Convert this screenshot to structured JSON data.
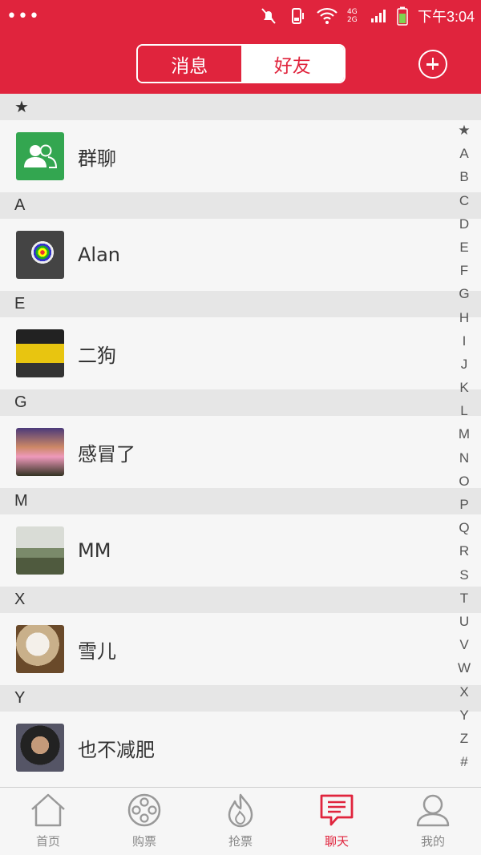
{
  "status_bar": {
    "time": "下午3:04",
    "network": "4G 2G"
  },
  "header": {
    "tabs": [
      {
        "label": "消息",
        "active": false
      },
      {
        "label": "好友",
        "active": true
      }
    ],
    "add_icon": "plus-circle-icon",
    "accent_color": "#e0243d"
  },
  "contacts": {
    "sections": [
      {
        "letter": "★",
        "items": [
          {
            "name": "群聊",
            "avatar": "group-chat-icon"
          }
        ]
      },
      {
        "letter": "A",
        "items": [
          {
            "name": "Alan",
            "avatar": "rubiks-cube-photo"
          }
        ]
      },
      {
        "letter": "E",
        "items": [
          {
            "name": "二狗",
            "avatar": "yellow-car-photo"
          }
        ]
      },
      {
        "letter": "G",
        "items": [
          {
            "name": "感冒了",
            "avatar": "person-photo"
          }
        ]
      },
      {
        "letter": "M",
        "items": [
          {
            "name": "MM",
            "avatar": "landscape-photo"
          }
        ]
      },
      {
        "letter": "X",
        "items": [
          {
            "name": "雪儿",
            "avatar": "baymax-toy-photo"
          }
        ]
      },
      {
        "letter": "Y",
        "items": [
          {
            "name": "也不减肥",
            "avatar": "portrait-photo"
          }
        ]
      }
    ]
  },
  "index_bar": [
    "★",
    "A",
    "B",
    "C",
    "D",
    "E",
    "F",
    "G",
    "H",
    "I",
    "J",
    "K",
    "L",
    "M",
    "N",
    "O",
    "P",
    "Q",
    "R",
    "S",
    "T",
    "U",
    "V",
    "W",
    "X",
    "Y",
    "Z",
    "#"
  ],
  "bottom_tabs": [
    {
      "label": "首页",
      "icon": "home-icon",
      "active": false
    },
    {
      "label": "购票",
      "icon": "film-reel-icon",
      "active": false
    },
    {
      "label": "抢票",
      "icon": "flame-icon",
      "active": false
    },
    {
      "label": "聊天",
      "icon": "chat-bubble-icon",
      "active": true
    },
    {
      "label": "我的",
      "icon": "user-icon",
      "active": false
    }
  ]
}
